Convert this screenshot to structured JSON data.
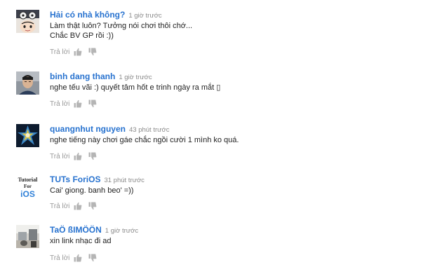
{
  "comments": [
    {
      "author": "Hải có nhà không?",
      "time": "1 giờ trước",
      "lines": [
        "Làm thật luôn? Tưởng nói chơi thôi chớ...",
        "Chắc BV GP rồi :))"
      ],
      "reply_label": "Trả lời",
      "avatar": "anime-character-avatar"
    },
    {
      "author": "binh dang thanh",
      "time": "1 giờ trước",
      "lines": [
        "nghe tếu vãi :) quyết tâm hốt e trinh ngày ra mắt ▯"
      ],
      "reply_label": "Trả lời",
      "avatar": "man-photo-avatar"
    },
    {
      "author": "quangnhut nguyen",
      "time": "43 phút trước",
      "lines": [
        "nghe tiếng này chơi gáe chắc ngồi cười 1 mình ko quá."
      ],
      "reply_label": "Trả lời",
      "avatar": "glowing-emblem-avatar"
    },
    {
      "author": "TUTs ForiOS",
      "time": "31 phút trước",
      "lines": [
        "Cai' giong. banh beo' =))"
      ],
      "reply_label": "Trả lời",
      "avatar": "tutorial-for-ios-logo",
      "avatar_text": [
        "Tutorial",
        "For",
        "iOS"
      ]
    },
    {
      "author": "TaÖ ßIMÖÖN",
      "time": "1 giờ trước",
      "lines": [
        "xin link nhạc  đi ad"
      ],
      "reply_label": "Trả lời",
      "avatar": "room-photo-avatar"
    }
  ],
  "colors": {
    "author": "#2772cf",
    "time": "#8a8a8a",
    "body_text": "#222222",
    "reply": "#9a9a9a",
    "thumb_icon": "#b5b5b5"
  },
  "icons": {
    "like": "thumbs-up-icon",
    "dislike": "thumbs-down-icon"
  }
}
